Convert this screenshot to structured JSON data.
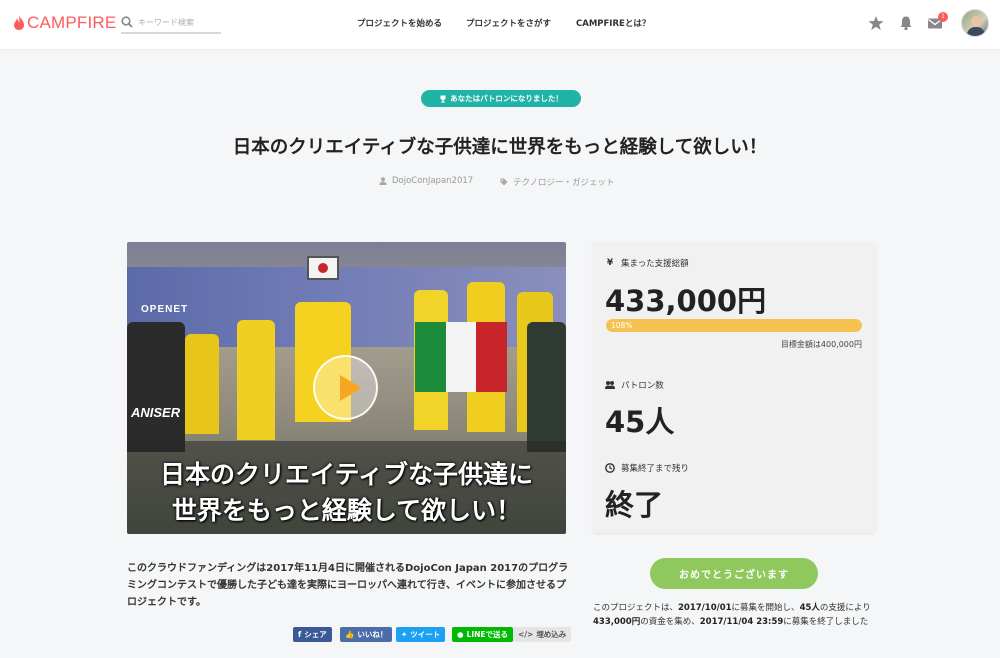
{
  "header": {
    "logo_text": "CAMPFIRE",
    "search_placeholder": "キーワード検索",
    "nav": [
      "プロジェクトを始める",
      "プロジェクトをさがす",
      "CAMPFIREとは？"
    ],
    "mail_badge": "1"
  },
  "patron_pill": "あなたはパトロンになりました！",
  "project": {
    "title": "日本のクリエイティブな子供達に世界をもっと経験して欲しい！",
    "owner": "DojoConJapan2017",
    "category": "テクノロジー・ガジェット"
  },
  "video": {
    "caption_line1": "日本のクリエイティブな子供達に",
    "caption_line2": "世界をもっと経験して欲しい！",
    "banner_text": "OPENET",
    "sign_text": "ANISER"
  },
  "stats": {
    "raised_label": "集まった支援総額",
    "raised_value": "433,000円",
    "progress_percent": 108,
    "progress_label": "108%",
    "goal_text": "目標金額は400,000円",
    "patrons_label": "パトロン数",
    "patrons_value": "45人",
    "remaining_label": "募集終了まで残り",
    "remaining_value": "終了"
  },
  "congrats_button": "おめでとうございます",
  "summary": {
    "prefix": "このプロジェクトは、",
    "start": "2017/10/01",
    "mid1": "に募集を開始し、",
    "count": "45人",
    "mid2": "の支援により",
    "amount": "433,000円",
    "mid3": "の資金を集め、",
    "end": "2017/11/04 23:59",
    "suffix": "に募集を終了しました"
  },
  "description": "このクラウドファンディングは2017年11月4日に開催されるDojoCon Japan 2017のプログラミングコンテストで優勝した子ども達を実際にヨーロッパへ連れて行き、イベントに参加させるプロジェクトです。",
  "share": {
    "facebook": "シェア",
    "like": "いいね！",
    "twitter": "ツイート",
    "line": "LINEで送る",
    "embed": "埋め込み"
  },
  "colors": {
    "brand": "#ff5a5f",
    "teal": "#1fb4a6",
    "progress": "#f5c14f",
    "congrats": "#8fc85d",
    "facebook": "#3b5998",
    "like": "#4a6ea9",
    "twitter": "#1da1f2",
    "line": "#00b900"
  }
}
